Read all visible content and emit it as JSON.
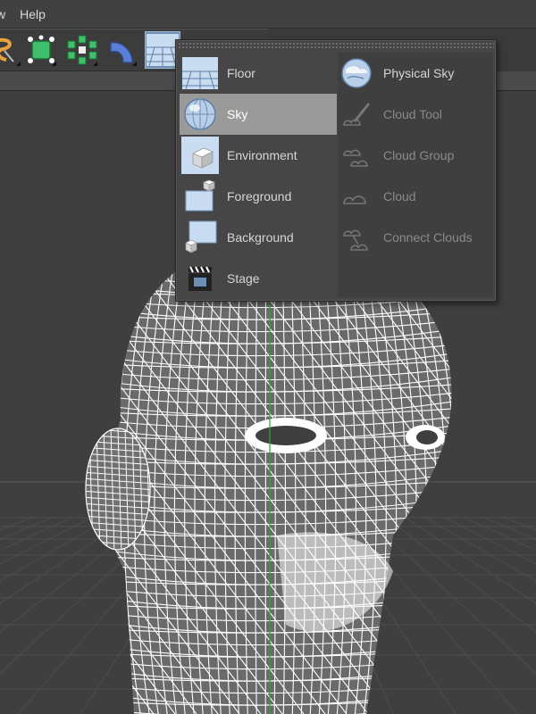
{
  "menubar": {
    "items": [
      {
        "label": "w"
      },
      {
        "label": "Help"
      }
    ]
  },
  "toolbar": {
    "buttons": [
      {
        "icon": "spline-pen-icon"
      },
      {
        "icon": "cube-generator-icon"
      },
      {
        "icon": "array-modifier-icon"
      },
      {
        "icon": "bend-deformer-icon"
      },
      {
        "icon": "floor-scene-icon",
        "active": true
      }
    ]
  },
  "palette": {
    "left_items": [
      {
        "label": "Floor",
        "icon": "floor-icon"
      },
      {
        "label": "Sky",
        "icon": "sky-icon",
        "selected": true
      },
      {
        "label": "Environment",
        "icon": "environment-icon"
      },
      {
        "label": "Foreground",
        "icon": "foreground-icon"
      },
      {
        "label": "Background",
        "icon": "background-icon"
      },
      {
        "label": "Stage",
        "icon": "stage-icon"
      }
    ],
    "right_items": [
      {
        "label": "Physical Sky",
        "icon": "physical-sky-icon",
        "enabled": true
      },
      {
        "label": "Cloud Tool",
        "icon": "cloud-tool-icon",
        "enabled": false
      },
      {
        "label": "Cloud Group",
        "icon": "cloud-group-icon",
        "enabled": false
      },
      {
        "label": "Cloud",
        "icon": "cloud-icon",
        "enabled": false
      },
      {
        "label": "Connect Clouds",
        "icon": "connect-clouds-icon",
        "enabled": false
      }
    ]
  },
  "colors": {
    "accent": "#6f8fb2",
    "selected_row": "#9a9a9a",
    "axis_y": "#2fa33a",
    "wireframe": "#ffffff"
  }
}
